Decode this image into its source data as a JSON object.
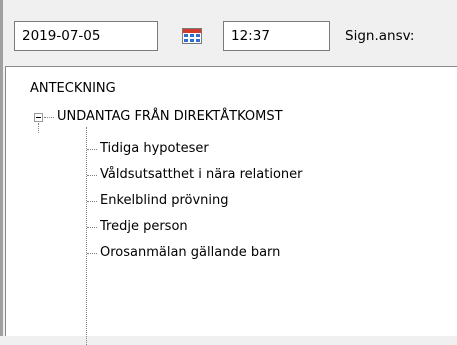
{
  "toolbar": {
    "date_value": "2019-07-05",
    "time_value": "12:37",
    "sign_label": "Sign.ansv:"
  },
  "tree": {
    "root_label": "ANTECKNING",
    "parent": {
      "label": "UNDANTAG FRÅN DIREKTÅTKOMST",
      "expanded": true,
      "children": [
        "Tidiga hypoteser",
        "Våldsutsatthet i nära relationer",
        "Enkelblind prövning",
        "Tredje person",
        "Orosanmälan gällande barn"
      ]
    }
  },
  "colors": {
    "calendar_header": "#d23a2a",
    "calendar_cells": "#2f6fcf"
  },
  "icons": [
    "calendar-icon",
    "collapse-icon"
  ]
}
